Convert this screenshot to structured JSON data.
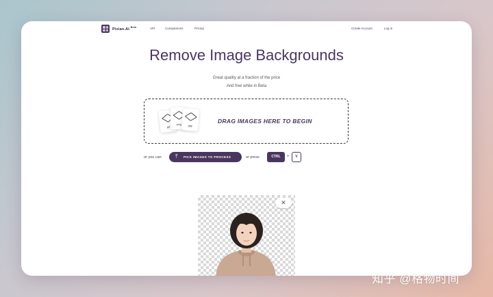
{
  "nav": {
    "brand": "Pixian.AI",
    "badge": "Beta",
    "links": [
      "API",
      "Comparisons",
      "Pricing"
    ],
    "create_account": "Create Account",
    "login": "Log in"
  },
  "hero": {
    "title": "Remove Image Backgrounds",
    "subtitle_line1": "Great quality at a fraction of the price",
    "subtitle_line2": "And free while in Beta"
  },
  "dropzone": {
    "label": "DRAG IMAGES HERE TO BEGIN",
    "file_types": [
      "gif",
      ".png",
      ".jpg"
    ]
  },
  "actions": {
    "or_you_can": "or you can",
    "pick_button": "PICK IMAGES TO PROCESS",
    "or_press": "or press",
    "ctrl_key": "CTRL",
    "plus": "+",
    "v_key": "V"
  },
  "preview": {
    "close_symbol": "✕"
  },
  "watermark": "知乎 @格物时间",
  "colors": {
    "accent": "#4a3560"
  }
}
